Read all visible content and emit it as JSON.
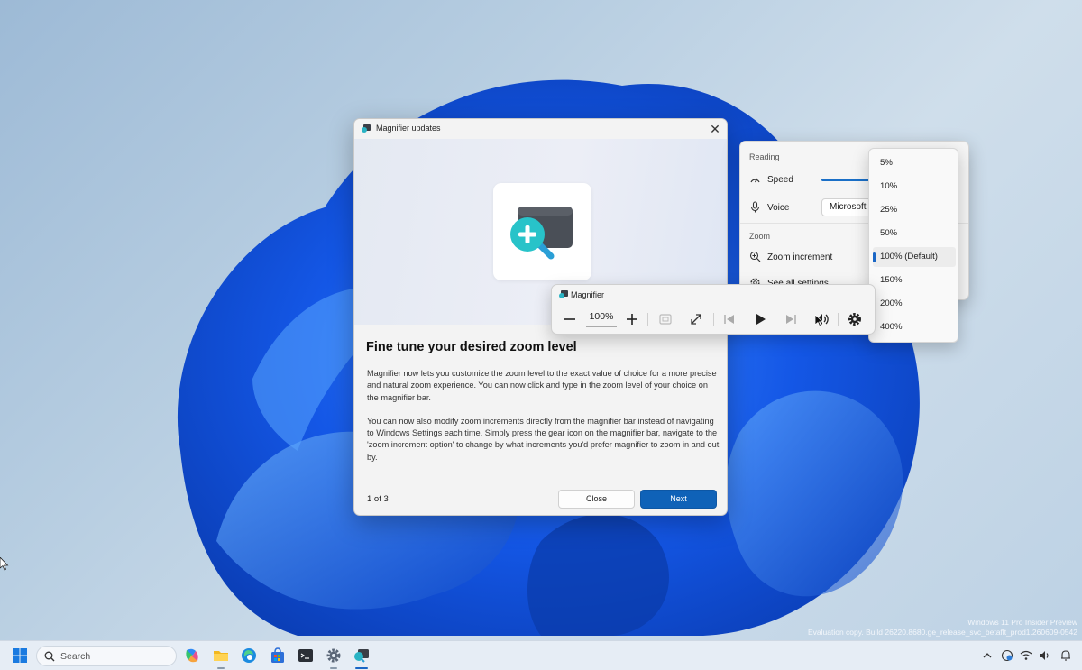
{
  "dialog": {
    "title": "Magnifier updates",
    "heading": "Fine tune your desired zoom level",
    "body": [
      "Magnifier now lets you customize the zoom level to the exact value of choice for a more precise and natural zoom experience. You can now click and type in the zoom level of your choice on the magnifier bar.",
      "You can now also modify zoom increments directly from the magnifier bar instead of navigating to Windows Settings each time. Simply press the gear icon on the magnifier bar, navigate to the 'zoom increment option' to change by what increments you'd prefer magnifier to zoom in and out by."
    ],
    "page_counter": "1 of 3",
    "close_label": "Close",
    "next_label": "Next",
    "close_icon": "close-icon"
  },
  "settings_flyout": {
    "reading_label": "Reading",
    "speed_label": "Speed",
    "voice_label": "Voice",
    "voice_value": "Microsoft",
    "zoom_label": "Zoom",
    "zoom_increment_label": "Zoom increment",
    "see_all_label": "See all settings"
  },
  "zoom_increment_dropdown": {
    "options": [
      "5%",
      "10%",
      "25%",
      "50%",
      "100% (Default)",
      "150%",
      "200%",
      "400%"
    ],
    "selected": "100% (Default)"
  },
  "magnifier_bar": {
    "title": "Magnifier",
    "zoom_value": "100%"
  },
  "watermark": {
    "line1": "Windows 11 Pro Insider Preview",
    "line2": "Evaluation copy. Build 26220.8680.ge_release_svc_betaflt_prod1.260609-0542"
  },
  "taskbar": {
    "search_placeholder": "Search"
  },
  "colors": {
    "accent": "#0f62b8",
    "wallpaper_blue": "#1a5fe0"
  }
}
